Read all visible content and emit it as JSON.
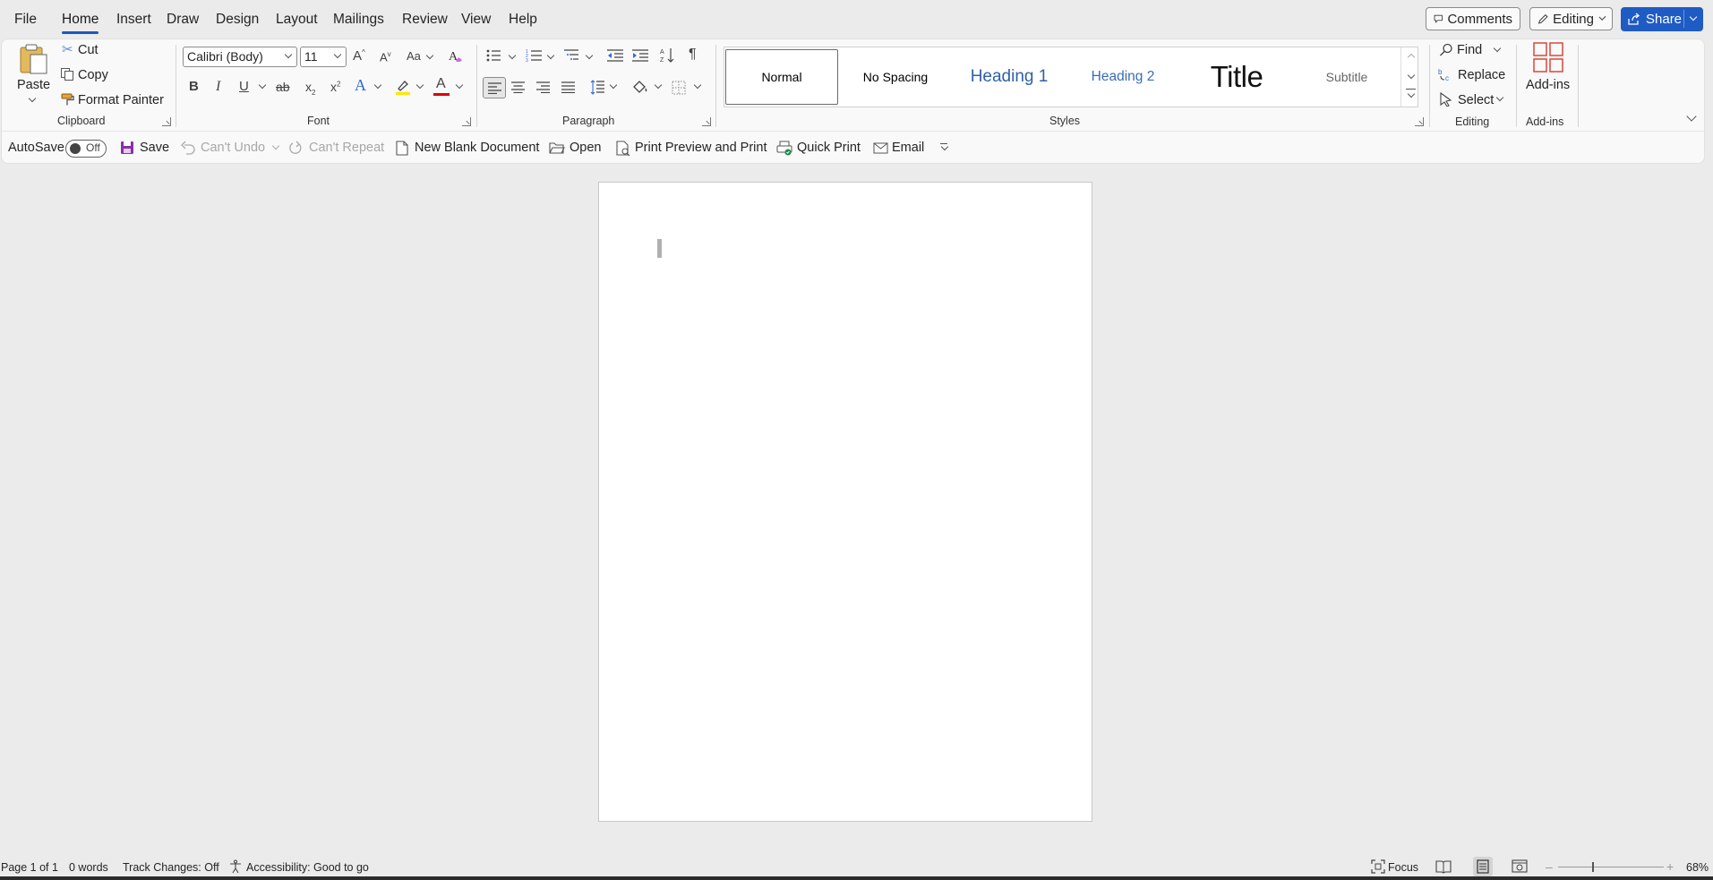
{
  "menu": {
    "tabs": [
      {
        "label": "File"
      },
      {
        "label": "Home"
      },
      {
        "label": "Insert"
      },
      {
        "label": "Draw"
      },
      {
        "label": "Design"
      },
      {
        "label": "Layout"
      },
      {
        "label": "Mailings"
      },
      {
        "label": "Review"
      },
      {
        "label": "View"
      },
      {
        "label": "Help"
      }
    ],
    "active_tab": "Home",
    "comments_label": "Comments",
    "editing_label": "Editing",
    "share_label": "Share"
  },
  "ribbon": {
    "clipboard": {
      "paste_label": "Paste",
      "cut_label": "Cut",
      "copy_label": "Copy",
      "format_painter_label": "Format Painter",
      "group_label": "Clipboard"
    },
    "font": {
      "font_name": "Calibri (Body)",
      "font_size": "11",
      "grow_glyph": "A",
      "shrink_glyph": "A",
      "case_glyph": "Aa",
      "bold": "B",
      "italic": "I",
      "underline": "U",
      "strike": "ab",
      "subscript_base": "x",
      "superscript_base": "x",
      "effects_glyph": "A",
      "color_glyph": "A",
      "highlight_color": "#ffe600",
      "font_color": "#e00000",
      "group_label": "Font"
    },
    "paragraph": {
      "pilcrow": "¶",
      "group_label": "Paragraph"
    },
    "styles": {
      "items": [
        {
          "label": "Normal"
        },
        {
          "label": "No Spacing"
        },
        {
          "label": "Heading 1"
        },
        {
          "label": "Heading 2"
        },
        {
          "label": "Title"
        },
        {
          "label": "Subtitle"
        }
      ],
      "selected": "Normal",
      "group_label": "Styles"
    },
    "editing": {
      "find_label": "Find",
      "replace_label": "Replace",
      "select_label": "Select",
      "group_label": "Editing"
    },
    "addins": {
      "addins_label": "Add-ins",
      "group_label": "Add-ins"
    }
  },
  "quick_access": {
    "autosave_label": "AutoSave",
    "autosave_state": "Off",
    "save_label": "Save",
    "undo_label": "Can't Undo",
    "repeat_label": "Can't Repeat",
    "new_doc_label": "New Blank Document",
    "open_label": "Open",
    "print_preview_label": "Print Preview and Print",
    "quick_print_label": "Quick Print",
    "email_label": "Email"
  },
  "status_bar": {
    "page": "Page 1 of 1",
    "words": "0 words",
    "track_changes": "Track Changes: Off",
    "accessibility": "Accessibility: Good to go",
    "focus_label": "Focus",
    "zoom": "68%",
    "zoom_fraction": 0.68
  },
  "colors": {
    "accent": "#185abd",
    "share_bg": "#1f5bc4",
    "save_icon": "#8a2fa8"
  }
}
